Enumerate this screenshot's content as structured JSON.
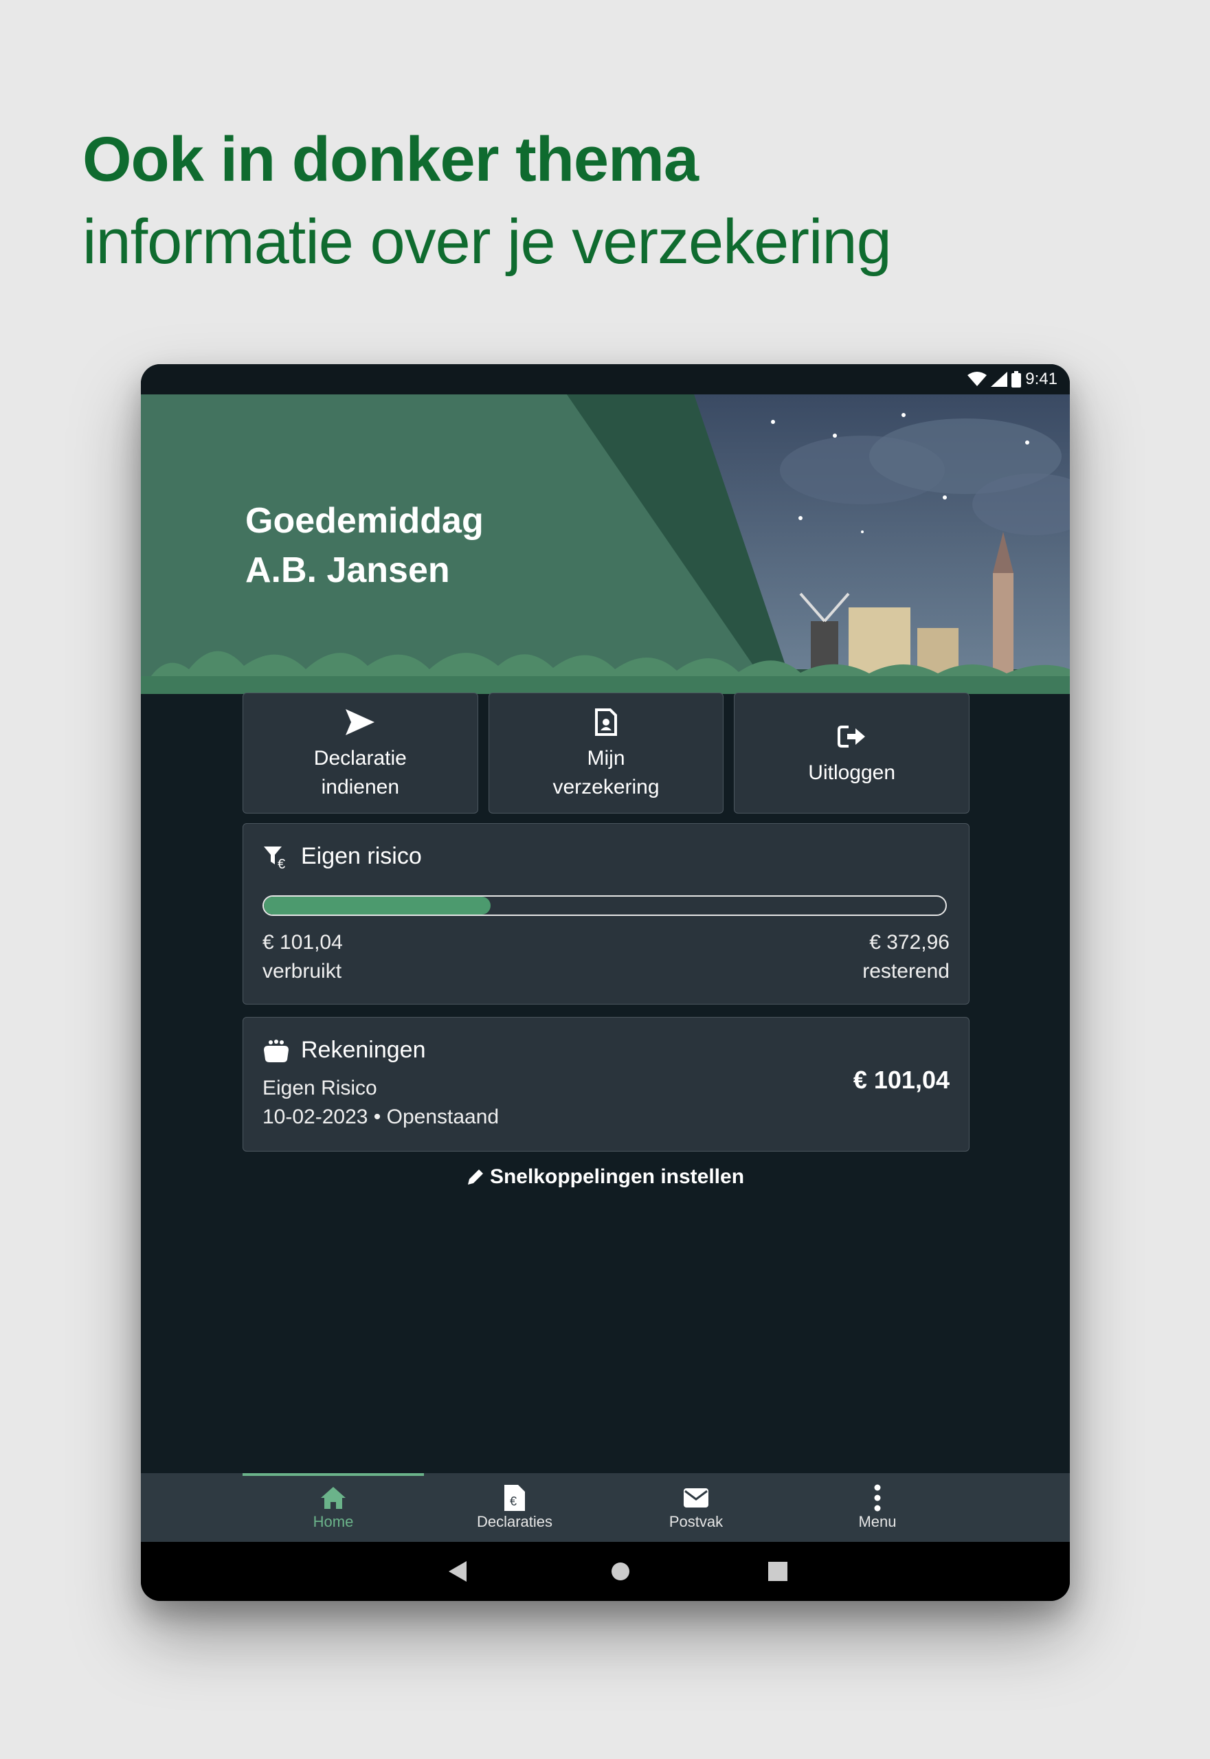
{
  "promo": {
    "title": "Ook in donker thema",
    "subtitle": "informatie over je verzekering"
  },
  "statusbar": {
    "time": "9:41",
    "icons": [
      "wifi-icon",
      "signal-icon",
      "battery-icon"
    ]
  },
  "greeting": {
    "line1": "Goedemiddag",
    "line2": "A.B. Jansen"
  },
  "quick_actions": [
    {
      "label": "Declaratie\nindienen",
      "icon": "send-icon"
    },
    {
      "label": "Mijn\nverzekering",
      "icon": "insurance-card-icon"
    },
    {
      "label": "Uitloggen",
      "icon": "logout-icon"
    }
  ],
  "eigen_risico": {
    "title": "Eigen risico",
    "icon": "deductible-icon",
    "used_amount": "€ 101,04",
    "used_label": "verbruikt",
    "remaining_amount": "€ 372,96",
    "remaining_label": "resterend",
    "progress_fraction": 0.333
  },
  "rekeningen": {
    "title": "Rekeningen",
    "icon": "wallet-icon",
    "item_name": "Eigen Risico",
    "item_meta": "10-02-2023 • Openstaand",
    "amount": "€ 101,04"
  },
  "shortcut": {
    "label": "Snelkoppelingen instellen",
    "icon": "pencil-icon"
  },
  "bottom_nav": [
    {
      "label": "Home",
      "icon": "home-icon",
      "active": true
    },
    {
      "label": "Declaraties",
      "icon": "invoice-icon",
      "active": false
    },
    {
      "label": "Postvak",
      "icon": "mail-icon",
      "active": false
    },
    {
      "label": "Menu",
      "icon": "more-vertical-icon",
      "active": false
    }
  ],
  "colors": {
    "brand_green": "#0f6b2f",
    "background_dark": "#111c22",
    "card": "#2a343c",
    "accent": "#6bb38a"
  }
}
